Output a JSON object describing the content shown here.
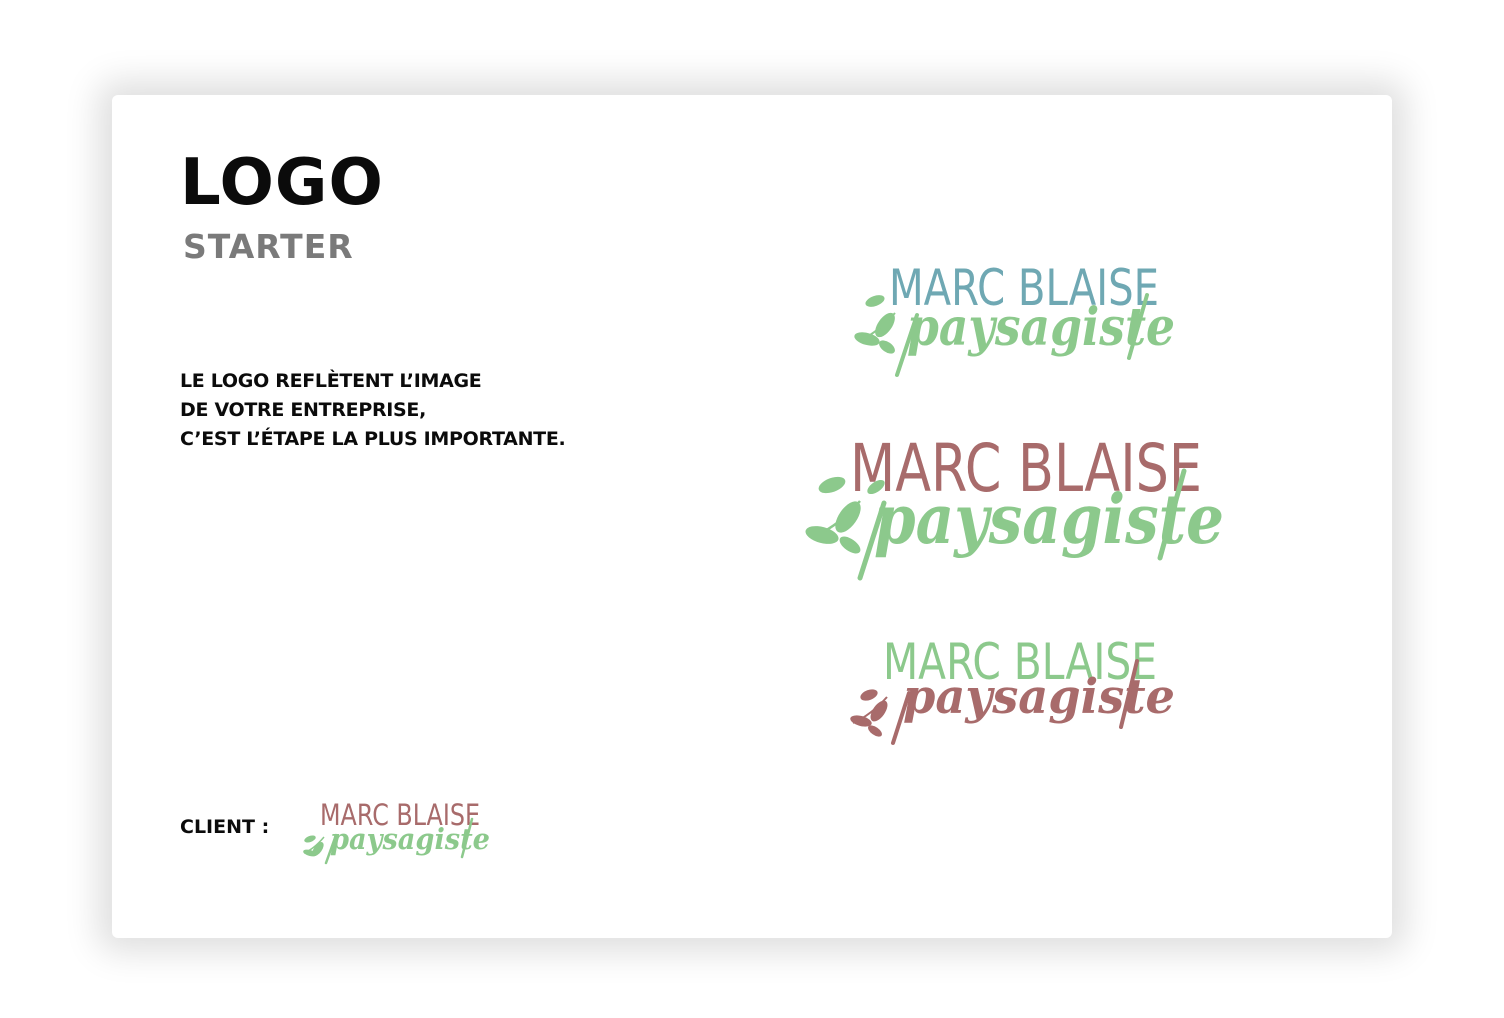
{
  "header": {
    "title": "LOGO",
    "subtitle": "STARTER"
  },
  "tagline": {
    "lines": [
      "LE LOGO REFLÈTENT L’IMAGE",
      "DE VOTRE ENTREPRISE,",
      "C’EST L’ÉTAPE LA PLUS IMPORTANTE."
    ]
  },
  "client": {
    "label": "CLIENT :",
    "logo": {
      "name": "MARC BLAISE",
      "tagline": "paysagiste",
      "name_color": "#a86b6b",
      "tagline_color": "#8cc98c",
      "leaf_color": "#8cc98c"
    }
  },
  "variants": [
    {
      "name": "MARC BLAISE",
      "tagline": "paysagiste",
      "name_color": "#6fa8b3",
      "tagline_color": "#8cc98c",
      "leaf_color": "#8cc98c"
    },
    {
      "name": "MARC BLAISE",
      "tagline": "paysagiste",
      "name_color": "#a86b6b",
      "tagline_color": "#8cc98c",
      "leaf_color": "#8cc98c"
    },
    {
      "name": "MARC BLAISE",
      "tagline": "paysagiste",
      "name_color": "#8cc98c",
      "tagline_color": "#a86b6b",
      "leaf_color": "#a86b6b"
    }
  ]
}
